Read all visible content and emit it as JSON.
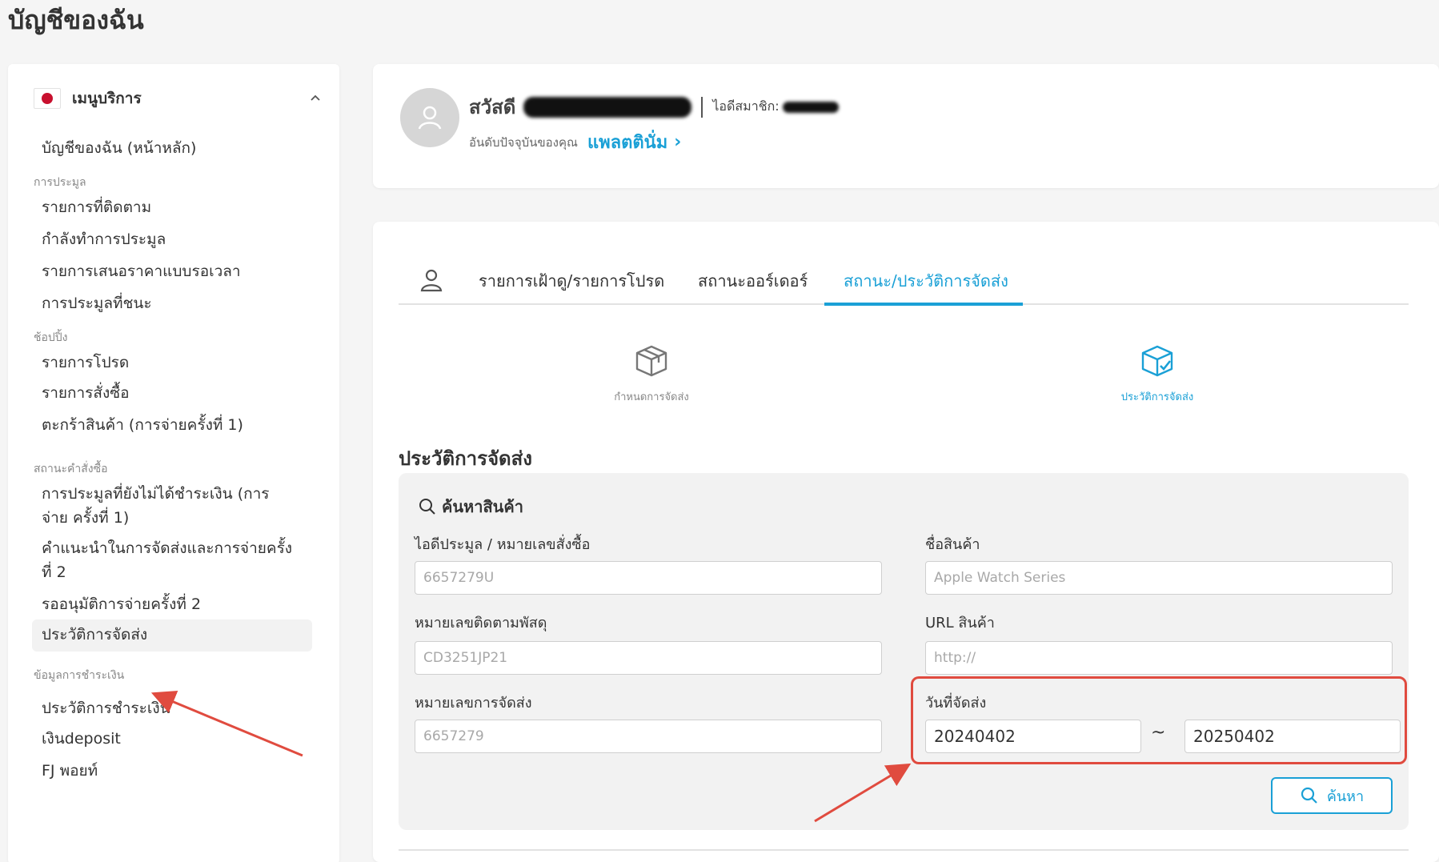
{
  "page": {
    "title": "บัญชีของฉัน"
  },
  "sidebar": {
    "header_label": "เมนูบริการ",
    "home": "บัญชีของฉัน (หน้าหลัก)",
    "sections": [
      {
        "title": "การประมูล",
        "items": [
          "รายการที่ติดตาม",
          "กำลังทำการประมูล",
          "รายการเสนอราคาแบบรอเวลา",
          "การประมูลที่ชนะ"
        ]
      },
      {
        "title": "ช้อปปิ้ง",
        "items": [
          "รายการโปรด",
          "รายการสั่งซื้อ",
          "ตะกร้าสินค้า (การจ่ายครั้งที่ 1)"
        ]
      },
      {
        "title": "สถานะคำสั่งซื้อ",
        "items": [
          "การประมูลที่ยังไม่ได้ชำระเงิน (การจ่าย ครั้งที่ 1)",
          "คำแนะนำในการจัดส่งและการจ่ายครั้งที่ 2",
          "รออนุมัติการจ่ายครั้งที่ 2",
          "ประวัติการจัดส่ง"
        ]
      },
      {
        "title": "ข้อมูลการชำระเงิน",
        "items": [
          "ประวัติการชำระเงิน",
          "เงินdeposit",
          "FJ พอยท์"
        ]
      }
    ],
    "active_item": "ประวัติการจัดส่ง"
  },
  "profile": {
    "greeting": "สวัสดี",
    "member_id_label": "ไอดีสมาชิก:",
    "rank_label": "อันดับปัจจุบันของคุณ",
    "rank_value": "แพลตตินั่ม",
    "rank_chevron": "›"
  },
  "tabs": {
    "items": [
      "รายการเฝ้าดู/รายการโปรด",
      "สถานะออร์เดอร์",
      "สถานะ/ประวัติการจัดส่ง"
    ],
    "active_index": 2
  },
  "subnav": {
    "items": [
      "กำหนดการจัดส่ง",
      "ประวัติการจัดส่ง"
    ],
    "active_index": 1
  },
  "section": {
    "title": "ประวัติการจัดส่ง",
    "search_title": "ค้นหาสินค้า"
  },
  "fields": {
    "auction_id": {
      "label": "ไอดีประมูล / หมายเลขสั่งซื้อ",
      "placeholder": "6657279U"
    },
    "product_name": {
      "label": "ชื่อสินค้า",
      "placeholder": "Apple Watch Series"
    },
    "tracking": {
      "label": "หมายเลขติดตามพัสดุ",
      "placeholder": "CD3251JP21"
    },
    "product_url": {
      "label": "URL สินค้า",
      "placeholder": "http://"
    },
    "shipment_no": {
      "label": "หมายเลขการจัดส่ง",
      "placeholder": "6657279"
    },
    "ship_date": {
      "label": "วันที่จัดส่ง",
      "from": "20240402",
      "to": "20250402",
      "separator": "~"
    }
  },
  "search_button": {
    "label": "ค้นหา"
  },
  "colors": {
    "accent": "#1aa0d6",
    "highlight": "#e04b3f",
    "flag_red": "#c8102e"
  }
}
